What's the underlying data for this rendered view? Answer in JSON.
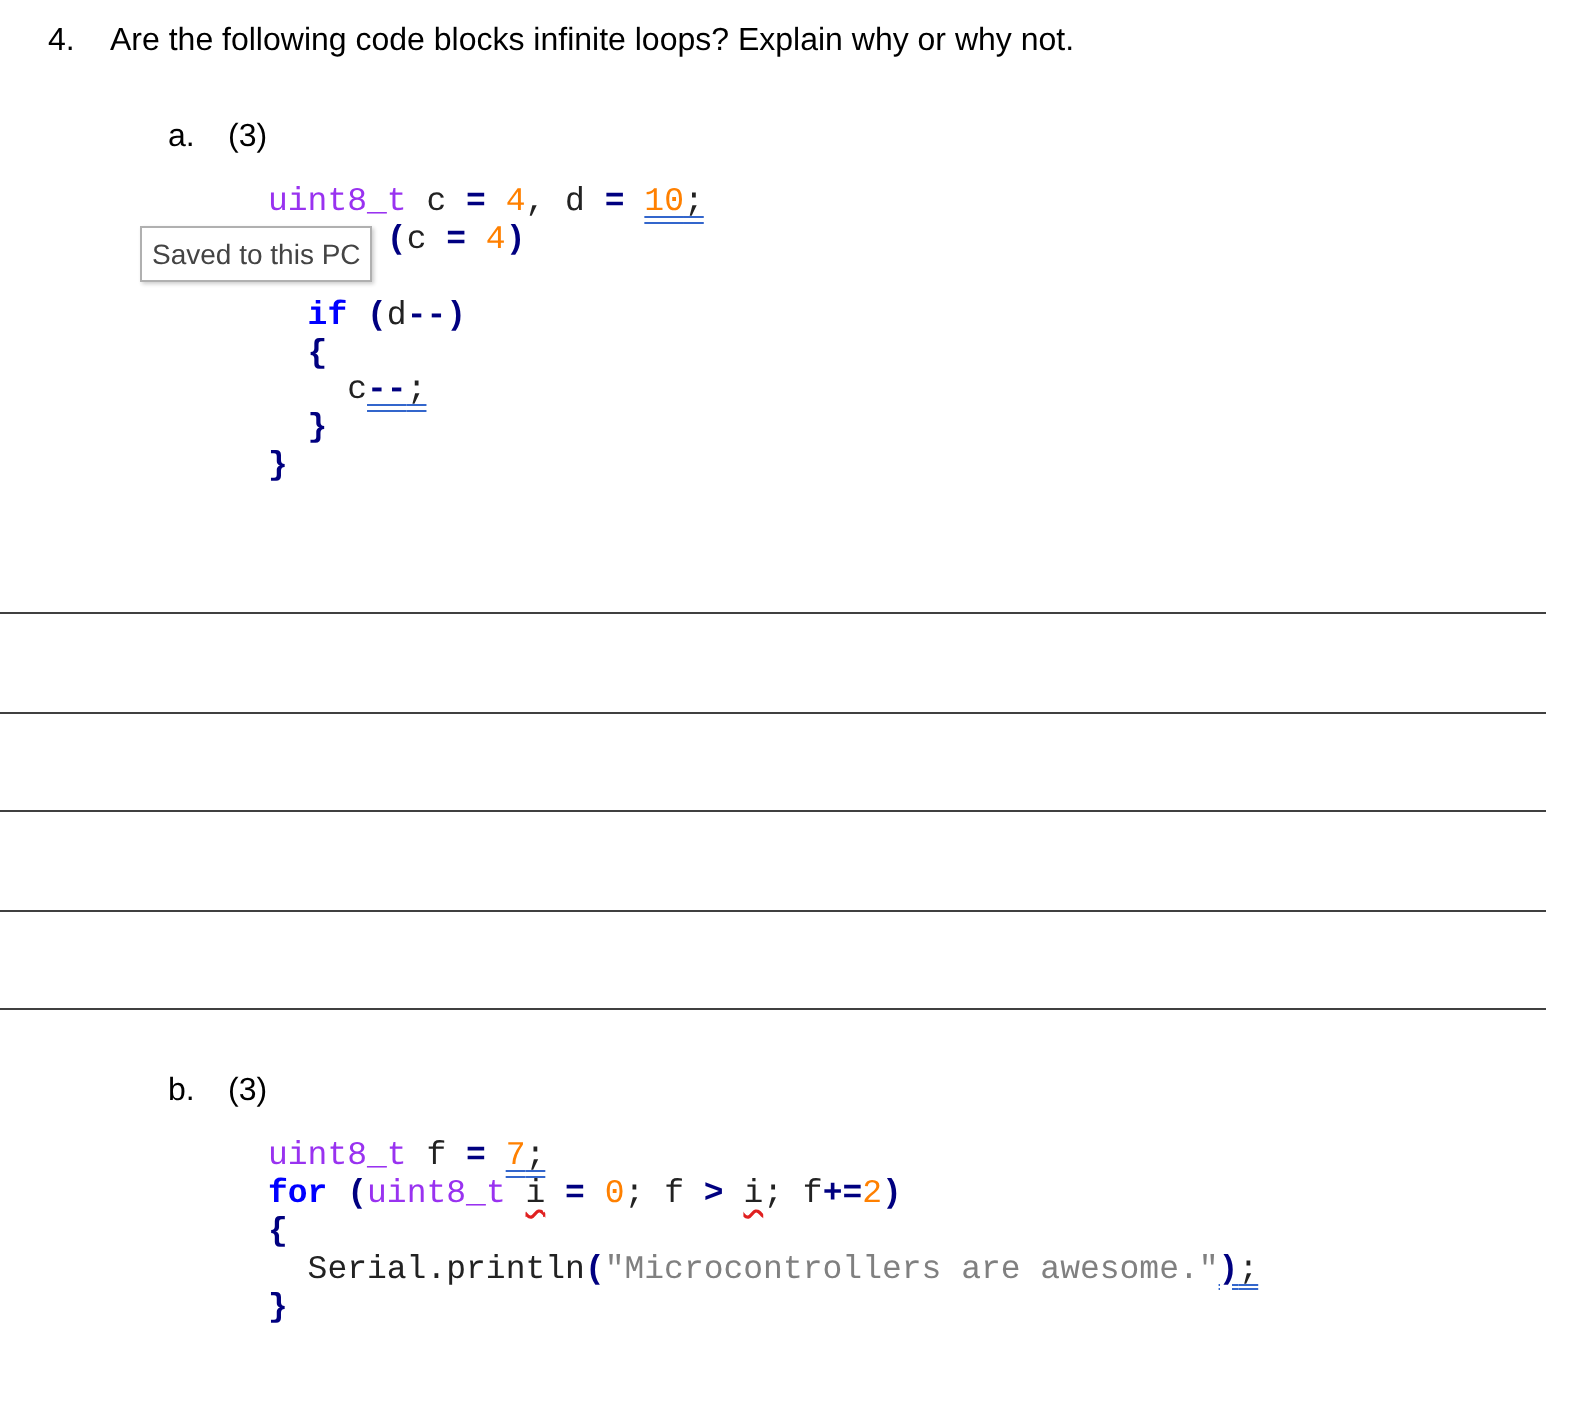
{
  "question": {
    "number": "4.",
    "text": "Are the following code blocks infinite loops? Explain why or why not."
  },
  "parts": [
    {
      "letter": "a.",
      "points": "(3)",
      "tooltip": "Saved to this PC",
      "answer_lines": true,
      "code": [
        {
          "kind": "code",
          "tokens": [
            {
              "kind": "type",
              "text": "uint8_t"
            },
            {
              "kind": "plain",
              "text": " c "
            },
            {
              "kind": "op",
              "text": "="
            },
            {
              "kind": "num",
              "text": " 4"
            },
            {
              "kind": "plain",
              "text": ", d "
            },
            {
              "kind": "op",
              "text": "= "
            },
            {
              "kind": "num",
              "text": "10",
              "grammar_flag": true
            },
            {
              "kind": "plain",
              "text": ";",
              "grammar_flag": true
            }
          ]
        },
        {
          "kind": "partly_covered",
          "tokens": [
            {
              "kind": "op",
              "text": "("
            },
            {
              "kind": "plain",
              "text": "c "
            },
            {
              "kind": "op",
              "text": "="
            },
            {
              "kind": "num",
              "text": " 4"
            },
            {
              "kind": "op",
              "text": ")"
            }
          ]
        },
        {
          "kind": "covered"
        },
        {
          "kind": "code",
          "tokens": [
            {
              "kind": "keyword",
              "text": "  if"
            },
            {
              "kind": "op",
              "text": " ("
            },
            {
              "kind": "plain",
              "text": "d"
            },
            {
              "kind": "op",
              "text": "--)"
            }
          ]
        },
        {
          "kind": "code",
          "tokens": [
            {
              "kind": "op",
              "text": "  {"
            }
          ]
        },
        {
          "kind": "code",
          "tokens": [
            {
              "kind": "plain",
              "text": "    c"
            },
            {
              "kind": "op",
              "text": "--",
              "grammar_flag": true
            },
            {
              "kind": "plain",
              "text": ";",
              "grammar_flag": true
            }
          ]
        },
        {
          "kind": "code",
          "tokens": [
            {
              "kind": "op",
              "text": "  }"
            }
          ]
        },
        {
          "kind": "code",
          "tokens": [
            {
              "kind": "op",
              "text": "}"
            }
          ]
        }
      ]
    },
    {
      "letter": "b.",
      "points": "(3)",
      "answer_lines": false,
      "code": [
        {
          "kind": "code",
          "tokens": [
            {
              "kind": "type",
              "text": "uint8_t"
            },
            {
              "kind": "plain",
              "text": " f "
            },
            {
              "kind": "op",
              "text": "= "
            },
            {
              "kind": "num",
              "text": "7",
              "grammar_flag": true
            },
            {
              "kind": "plain",
              "text": ";",
              "grammar_flag": true
            }
          ]
        },
        {
          "kind": "code",
          "tokens": [
            {
              "kind": "keyword",
              "text": "for"
            },
            {
              "kind": "op",
              "text": " ("
            },
            {
              "kind": "type",
              "text": "uint8_t "
            },
            {
              "kind": "plain",
              "text": "i",
              "spelling_flag": true
            },
            {
              "kind": "op",
              "text": " = "
            },
            {
              "kind": "num",
              "text": "0"
            },
            {
              "kind": "plain",
              "text": "; f "
            },
            {
              "kind": "op",
              "text": "> "
            },
            {
              "kind": "plain",
              "text": "i",
              "spelling_flag": true
            },
            {
              "kind": "plain",
              "text": "; f"
            },
            {
              "kind": "op",
              "text": "+="
            },
            {
              "kind": "num",
              "text": "2"
            },
            {
              "kind": "op",
              "text": ")"
            }
          ]
        },
        {
          "kind": "code",
          "tokens": [
            {
              "kind": "op",
              "text": "{"
            }
          ]
        },
        {
          "kind": "code",
          "tokens": [
            {
              "kind": "plain",
              "text": "  Serial.println"
            },
            {
              "kind": "op",
              "text": "("
            },
            {
              "kind": "str",
              "text": "\"Microcontrollers are awesome.\""
            },
            {
              "kind": "op",
              "text": ")",
              "grammar_flag": true
            },
            {
              "kind": "plain",
              "text": ";",
              "grammar_flag": true
            }
          ]
        },
        {
          "kind": "code",
          "tokens": [
            {
              "kind": "op",
              "text": "}"
            }
          ]
        }
      ]
    }
  ]
}
